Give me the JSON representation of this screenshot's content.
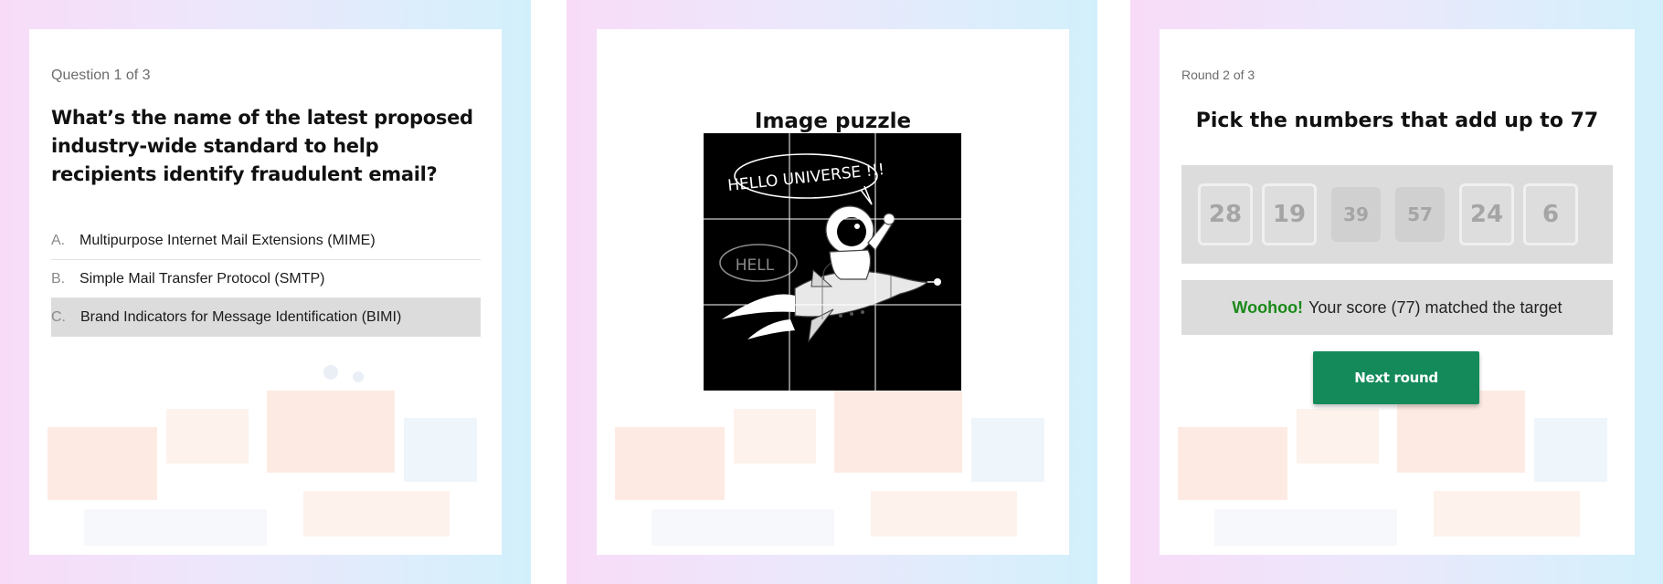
{
  "quiz": {
    "counter": "Question 1 of 3",
    "question": "What’s the name of the latest proposed industry-wide standard to help recipients identify fraudulent email?",
    "options": [
      {
        "letter": "A.",
        "text": "Multipurpose Internet Mail Extensions (MIME)",
        "selected": false
      },
      {
        "letter": "B.",
        "text": "Simple Mail Transfer Protocol (SMTP)",
        "selected": false
      },
      {
        "letter": "C.",
        "text": "Brand Indicators for Message Identification (BIMI)",
        "selected": true
      }
    ]
  },
  "puzzle": {
    "title": "Image puzzle",
    "grid": "3x3",
    "bubble_text": "HELLO UNIVERSE !!!",
    "bubble_text_partial": "HELL"
  },
  "numbers_game": {
    "round_counter": "Round 2 of 3",
    "title": "Pick the numbers that add up to 77",
    "tiles": [
      {
        "value": "28",
        "picked": false
      },
      {
        "value": "19",
        "picked": false
      },
      {
        "value": "39",
        "picked": true
      },
      {
        "value": "57",
        "picked": true
      },
      {
        "value": "24",
        "picked": false
      },
      {
        "value": "6",
        "picked": false
      }
    ],
    "result_highlight": "Woohoo!",
    "result_text": "Your score (77) matched the target",
    "next_button": "Next round"
  },
  "colors": {
    "accent_green": "#148a5a",
    "success_text": "#1a8a1a",
    "selection_gray": "#dcdcdc"
  }
}
